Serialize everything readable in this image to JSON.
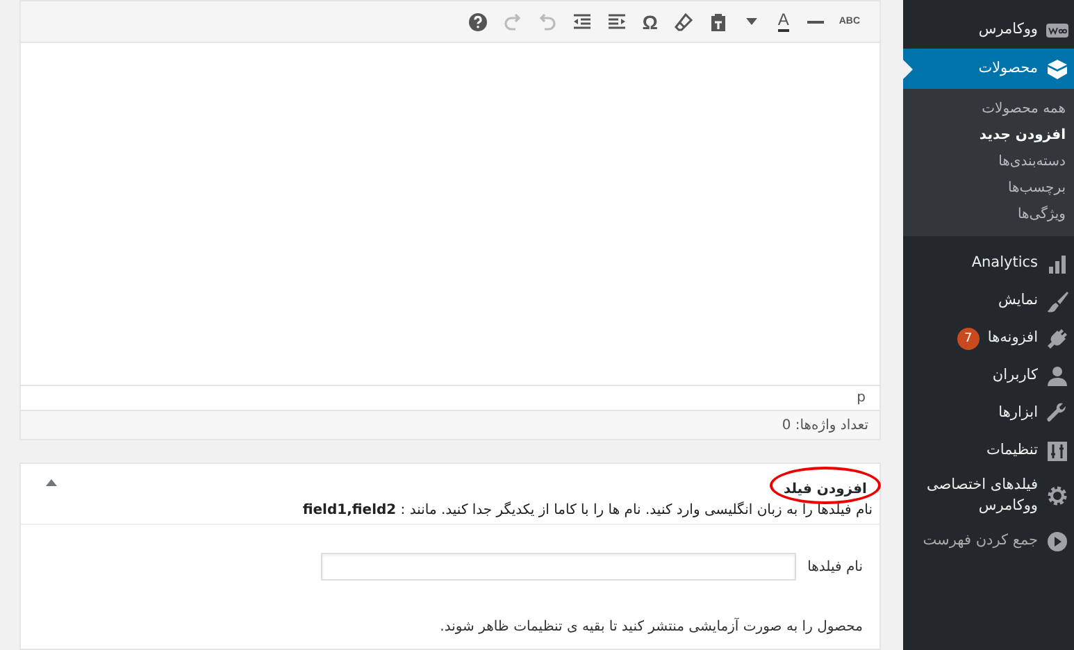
{
  "toolbar": [
    {
      "kind": "small",
      "glyph": "ABC",
      "disabled": false
    },
    {
      "kind": "hr",
      "disabled": false
    },
    {
      "kind": "textcolor",
      "glyph": "A",
      "disabled": false
    },
    {
      "kind": "caret",
      "disabled": false
    },
    {
      "kind": "paste",
      "disabled": false
    },
    {
      "kind": "eraser",
      "disabled": false
    },
    {
      "kind": "glyph",
      "glyph": "Ω",
      "disabled": false
    },
    {
      "kind": "indent",
      "disabled": false
    },
    {
      "kind": "outdent",
      "disabled": false
    },
    {
      "kind": "undo",
      "disabled": true
    },
    {
      "kind": "redo",
      "disabled": true
    },
    {
      "kind": "help",
      "disabled": false
    }
  ],
  "editor": {
    "path": "p",
    "word_count": "تعداد واژه‌ها: 0"
  },
  "metabox": {
    "title": "افزودن فیلد",
    "title_highlighted": true,
    "description": "نام فیلدها را به زبان انگلیسی وارد کنید. نام ها را با کاما از یکدیگر جدا کنید. مانند : **field1,field2**",
    "field_label": "نام فیلدها",
    "notice": "محصول را به صورت آزمایشی منتشر کنید تا بقیه ی تنظیمات ظاهر شوند."
  },
  "sidebar": {
    "items": [
      {
        "label": "ووکامرس",
        "selected": false
      },
      {
        "label": "محصولات",
        "selected": true,
        "children": [
          {
            "label": "همه محصولات",
            "selected": false
          },
          {
            "label": "افزودن جدید",
            "selected": true
          },
          {
            "label": "دسته‌بندی‌ها",
            "selected": false
          },
          {
            "label": "برچسب‌ها",
            "selected": false
          },
          {
            "label": "ویژگی‌ها",
            "selected": false
          }
        ]
      },
      {
        "label": "Analytics",
        "selected": false
      },
      {
        "label": "نمایش",
        "selected": false
      },
      {
        "label": "افزونه‌ها",
        "selected": false,
        "badge": "7"
      },
      {
        "label": "کاربران",
        "selected": false
      },
      {
        "label": "ابزارها",
        "selected": false
      },
      {
        "label": "تنظیمات",
        "selected": false
      },
      {
        "label": "فیلدهای اختصاصی ووکامرس",
        "selected": false
      },
      {
        "label": "جمع کردن فهرست",
        "selected": false
      }
    ]
  }
}
